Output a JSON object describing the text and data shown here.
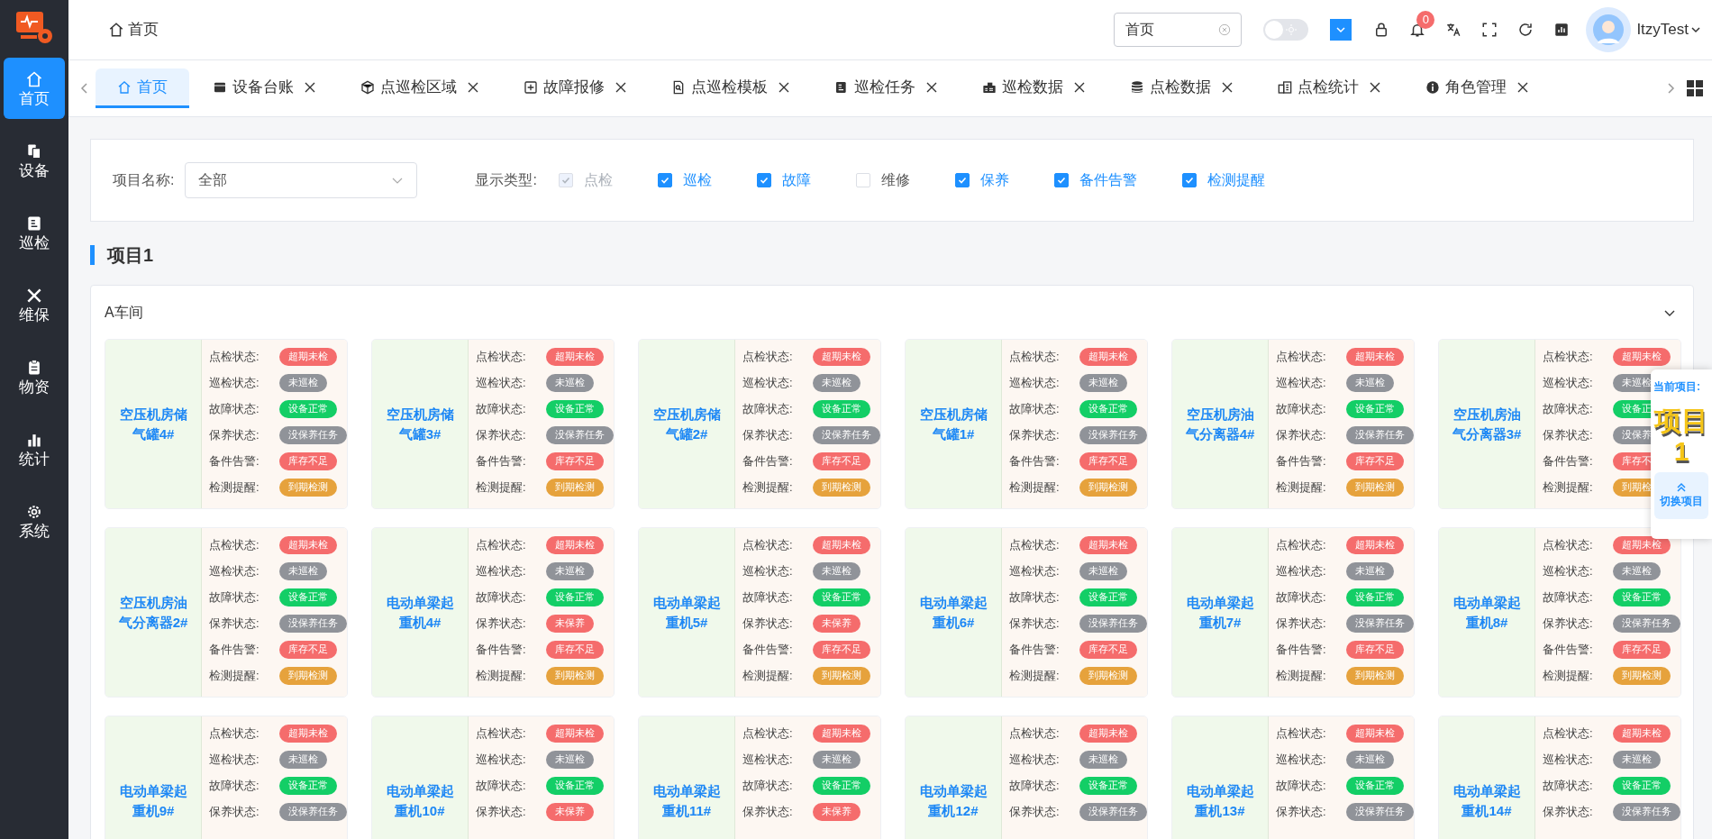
{
  "sidebar": {
    "items": [
      {
        "label": "首页",
        "selected": true
      },
      {
        "label": "设备",
        "selected": false
      },
      {
        "label": "巡检",
        "selected": false
      },
      {
        "label": "维保",
        "selected": false
      },
      {
        "label": "物资",
        "selected": false
      },
      {
        "label": "统计",
        "selected": false
      },
      {
        "label": "系统",
        "selected": false
      }
    ]
  },
  "header": {
    "breadcrumb": "首页",
    "search": {
      "value": "首页"
    },
    "theme_toggle": {
      "on": false
    },
    "notifications": {
      "count": "0"
    },
    "user": "ItzyTest"
  },
  "tabs": [
    {
      "label": "首页",
      "selected": true,
      "closable": false
    },
    {
      "label": "设备台账",
      "selected": false,
      "closable": true
    },
    {
      "label": "点巡检区域",
      "selected": false,
      "closable": true
    },
    {
      "label": "故障报修",
      "selected": false,
      "closable": true
    },
    {
      "label": "点巡检模板",
      "selected": false,
      "closable": true
    },
    {
      "label": "巡检任务",
      "selected": false,
      "closable": true
    },
    {
      "label": "巡检数据",
      "selected": false,
      "closable": true
    },
    {
      "label": "点检数据",
      "selected": false,
      "closable": true
    },
    {
      "label": "点检统计",
      "selected": false,
      "closable": true
    },
    {
      "label": "角色管理",
      "selected": false,
      "closable": true
    }
  ],
  "filter": {
    "project_label": "项目名称:",
    "project_select": {
      "value": "全部"
    },
    "type_label": "显示类型:",
    "types": [
      {
        "label": "点检",
        "checked": true,
        "disabled": true
      },
      {
        "label": "巡检",
        "checked": true,
        "disabled": false
      },
      {
        "label": "故障",
        "checked": true,
        "disabled": false
      },
      {
        "label": "维修",
        "checked": false,
        "disabled": false
      },
      {
        "label": "保养",
        "checked": true,
        "disabled": false
      },
      {
        "label": "备件告警",
        "checked": true,
        "disabled": false
      },
      {
        "label": "检测提醒",
        "checked": true,
        "disabled": false
      }
    ]
  },
  "section_title": "项目1",
  "workshop": {
    "title": "A车间",
    "expanded": true,
    "devices": [
      {
        "name": "空压机房储气罐4#",
        "statuses": [
          {
            "label": "点检状态:",
            "value": "超期未检",
            "color": "#f56c6c"
          },
          {
            "label": "巡检状态:",
            "value": "未巡检",
            "color": "#909399"
          },
          {
            "label": "故障状态:",
            "value": "设备正常",
            "color": "#13ce66"
          },
          {
            "label": "保养状态:",
            "value": "没保养任务",
            "color": "#909399"
          },
          {
            "label": "备件告警:",
            "value": "库存不足",
            "color": "#f56c6c"
          },
          {
            "label": "检测提醒:",
            "value": "到期检测",
            "color": "#e6a23c"
          }
        ]
      },
      {
        "name": "空压机房储气罐3#",
        "statuses": [
          {
            "label": "点检状态:",
            "value": "超期未检",
            "color": "#f56c6c"
          },
          {
            "label": "巡检状态:",
            "value": "未巡检",
            "color": "#909399"
          },
          {
            "label": "故障状态:",
            "value": "设备正常",
            "color": "#13ce66"
          },
          {
            "label": "保养状态:",
            "value": "没保养任务",
            "color": "#909399"
          },
          {
            "label": "备件告警:",
            "value": "库存不足",
            "color": "#f56c6c"
          },
          {
            "label": "检测提醒:",
            "value": "到期检测",
            "color": "#e6a23c"
          }
        ]
      },
      {
        "name": "空压机房储气罐2#",
        "statuses": [
          {
            "label": "点检状态:",
            "value": "超期未检",
            "color": "#f56c6c"
          },
          {
            "label": "巡检状态:",
            "value": "未巡检",
            "color": "#909399"
          },
          {
            "label": "故障状态:",
            "value": "设备正常",
            "color": "#13ce66"
          },
          {
            "label": "保养状态:",
            "value": "没保养任务",
            "color": "#909399"
          },
          {
            "label": "备件告警:",
            "value": "库存不足",
            "color": "#f56c6c"
          },
          {
            "label": "检测提醒:",
            "value": "到期检测",
            "color": "#e6a23c"
          }
        ]
      },
      {
        "name": "空压机房储气罐1#",
        "statuses": [
          {
            "label": "点检状态:",
            "value": "超期未检",
            "color": "#f56c6c"
          },
          {
            "label": "巡检状态:",
            "value": "未巡检",
            "color": "#909399"
          },
          {
            "label": "故障状态:",
            "value": "设备正常",
            "color": "#13ce66"
          },
          {
            "label": "保养状态:",
            "value": "没保养任务",
            "color": "#909399"
          },
          {
            "label": "备件告警:",
            "value": "库存不足",
            "color": "#f56c6c"
          },
          {
            "label": "检测提醒:",
            "value": "到期检测",
            "color": "#e6a23c"
          }
        ]
      },
      {
        "name": "空压机房油气分离器4#",
        "statuses": [
          {
            "label": "点检状态:",
            "value": "超期未检",
            "color": "#f56c6c"
          },
          {
            "label": "巡检状态:",
            "value": "未巡检",
            "color": "#909399"
          },
          {
            "label": "故障状态:",
            "value": "设备正常",
            "color": "#13ce66"
          },
          {
            "label": "保养状态:",
            "value": "没保养任务",
            "color": "#909399"
          },
          {
            "label": "备件告警:",
            "value": "库存不足",
            "color": "#f56c6c"
          },
          {
            "label": "检测提醒:",
            "value": "到期检测",
            "color": "#e6a23c"
          }
        ]
      },
      {
        "name": "空压机房油气分离器3#",
        "statuses": [
          {
            "label": "点检状态:",
            "value": "超期未检",
            "color": "#f56c6c"
          },
          {
            "label": "巡检状态:",
            "value": "未巡检",
            "color": "#909399"
          },
          {
            "label": "故障状态:",
            "value": "设备正",
            "color": "#13ce66"
          },
          {
            "label": "保养状态:",
            "value": "没保养",
            "color": "#909399"
          },
          {
            "label": "备件告警:",
            "value": "库存不",
            "color": "#f56c6c"
          },
          {
            "label": "检测提醒:",
            "value": "到期检",
            "color": "#e6a23c"
          }
        ]
      },
      {
        "name": "空压机房油气分离器2#",
        "statuses": [
          {
            "label": "点检状态:",
            "value": "超期未检",
            "color": "#f56c6c"
          },
          {
            "label": "巡检状态:",
            "value": "未巡检",
            "color": "#909399"
          },
          {
            "label": "故障状态:",
            "value": "设备正常",
            "color": "#13ce66"
          },
          {
            "label": "保养状态:",
            "value": "没保养任务",
            "color": "#909399"
          },
          {
            "label": "备件告警:",
            "value": "库存不足",
            "color": "#f56c6c"
          },
          {
            "label": "检测提醒:",
            "value": "到期检测",
            "color": "#e6a23c"
          }
        ]
      },
      {
        "name": "电动单梁起重机4#",
        "statuses": [
          {
            "label": "点检状态:",
            "value": "超期未检",
            "color": "#f56c6c"
          },
          {
            "label": "巡检状态:",
            "value": "未巡检",
            "color": "#909399"
          },
          {
            "label": "故障状态:",
            "value": "设备正常",
            "color": "#13ce66"
          },
          {
            "label": "保养状态:",
            "value": "未保养",
            "color": "#f56c6c"
          },
          {
            "label": "备件告警:",
            "value": "库存不足",
            "color": "#f56c6c"
          },
          {
            "label": "检测提醒:",
            "value": "到期检测",
            "color": "#e6a23c"
          }
        ]
      },
      {
        "name": "电动单梁起重机5#",
        "statuses": [
          {
            "label": "点检状态:",
            "value": "超期未检",
            "color": "#f56c6c"
          },
          {
            "label": "巡检状态:",
            "value": "未巡检",
            "color": "#909399"
          },
          {
            "label": "故障状态:",
            "value": "设备正常",
            "color": "#13ce66"
          },
          {
            "label": "保养状态:",
            "value": "未保养",
            "color": "#f56c6c"
          },
          {
            "label": "备件告警:",
            "value": "库存不足",
            "color": "#f56c6c"
          },
          {
            "label": "检测提醒:",
            "value": "到期检测",
            "color": "#e6a23c"
          }
        ]
      },
      {
        "name": "电动单梁起重机6#",
        "statuses": [
          {
            "label": "点检状态:",
            "value": "超期未检",
            "color": "#f56c6c"
          },
          {
            "label": "巡检状态:",
            "value": "未巡检",
            "color": "#909399"
          },
          {
            "label": "故障状态:",
            "value": "设备正常",
            "color": "#13ce66"
          },
          {
            "label": "保养状态:",
            "value": "没保养任务",
            "color": "#909399"
          },
          {
            "label": "备件告警:",
            "value": "库存不足",
            "color": "#f56c6c"
          },
          {
            "label": "检测提醒:",
            "value": "到期检测",
            "color": "#e6a23c"
          }
        ]
      },
      {
        "name": "电动单梁起重机7#",
        "statuses": [
          {
            "label": "点检状态:",
            "value": "超期未检",
            "color": "#f56c6c"
          },
          {
            "label": "巡检状态:",
            "value": "未巡检",
            "color": "#909399"
          },
          {
            "label": "故障状态:",
            "value": "设备正常",
            "color": "#13ce66"
          },
          {
            "label": "保养状态:",
            "value": "没保养任务",
            "color": "#909399"
          },
          {
            "label": "备件告警:",
            "value": "库存不足",
            "color": "#f56c6c"
          },
          {
            "label": "检测提醒:",
            "value": "到期检测",
            "color": "#e6a23c"
          }
        ]
      },
      {
        "name": "电动单梁起重机8#",
        "statuses": [
          {
            "label": "点检状态:",
            "value": "超期未检",
            "color": "#f56c6c"
          },
          {
            "label": "巡检状态:",
            "value": "未巡检",
            "color": "#909399"
          },
          {
            "label": "故障状态:",
            "value": "设备正常",
            "color": "#13ce66"
          },
          {
            "label": "保养状态:",
            "value": "没保养任务",
            "color": "#909399"
          },
          {
            "label": "备件告警:",
            "value": "库存不足",
            "color": "#f56c6c"
          },
          {
            "label": "检测提醒:",
            "value": "到期检测",
            "color": "#e6a23c"
          }
        ]
      },
      {
        "name": "电动单梁起重机9#",
        "statuses": [
          {
            "label": "点检状态:",
            "value": "超期未检",
            "color": "#f56c6c"
          },
          {
            "label": "巡检状态:",
            "value": "未巡检",
            "color": "#909399"
          },
          {
            "label": "故障状态:",
            "value": "设备正常",
            "color": "#13ce66"
          },
          {
            "label": "保养状态:",
            "value": "没保养任务",
            "color": "#909399"
          }
        ]
      },
      {
        "name": "电动单梁起重机10#",
        "statuses": [
          {
            "label": "点检状态:",
            "value": "超期未检",
            "color": "#f56c6c"
          },
          {
            "label": "巡检状态:",
            "value": "未巡检",
            "color": "#909399"
          },
          {
            "label": "故障状态:",
            "value": "设备正常",
            "color": "#13ce66"
          },
          {
            "label": "保养状态:",
            "value": "未保养",
            "color": "#f56c6c"
          }
        ]
      },
      {
        "name": "电动单梁起重机11#",
        "statuses": [
          {
            "label": "点检状态:",
            "value": "超期未检",
            "color": "#f56c6c"
          },
          {
            "label": "巡检状态:",
            "value": "未巡检",
            "color": "#909399"
          },
          {
            "label": "故障状态:",
            "value": "设备正常",
            "color": "#13ce66"
          },
          {
            "label": "保养状态:",
            "value": "未保养",
            "color": "#f56c6c"
          }
        ]
      },
      {
        "name": "电动单梁起重机12#",
        "statuses": [
          {
            "label": "点检状态:",
            "value": "超期未检",
            "color": "#f56c6c"
          },
          {
            "label": "巡检状态:",
            "value": "未巡检",
            "color": "#909399"
          },
          {
            "label": "故障状态:",
            "value": "设备正常",
            "color": "#13ce66"
          },
          {
            "label": "保养状态:",
            "value": "没保养任务",
            "color": "#909399"
          }
        ]
      },
      {
        "name": "电动单梁起重机13#",
        "statuses": [
          {
            "label": "点检状态:",
            "value": "超期未检",
            "color": "#f56c6c"
          },
          {
            "label": "巡检状态:",
            "value": "未巡检",
            "color": "#909399"
          },
          {
            "label": "故障状态:",
            "value": "设备正常",
            "color": "#13ce66"
          },
          {
            "label": "保养状态:",
            "value": "没保养任务",
            "color": "#909399"
          }
        ]
      },
      {
        "name": "电动单梁起重机14#",
        "statuses": [
          {
            "label": "点检状态:",
            "value": "超期未检",
            "color": "#f56c6c"
          },
          {
            "label": "巡检状态:",
            "value": "未巡检",
            "color": "#909399"
          },
          {
            "label": "故障状态:",
            "value": "设备正常",
            "color": "#13ce66"
          },
          {
            "label": "保养状态:",
            "value": "没保养任务",
            "color": "#909399"
          }
        ]
      }
    ]
  },
  "project_panel": {
    "label": "当前项目:",
    "project": "项目1",
    "switch_button": "切换项目"
  }
}
